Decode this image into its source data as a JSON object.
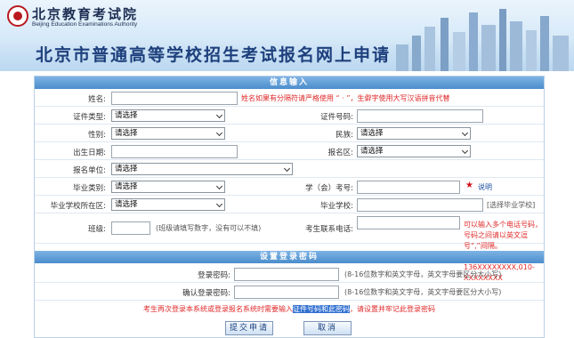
{
  "header": {
    "logo_cn": "北京教育考试院",
    "logo_en": "Beijing Education Examinations Authority",
    "title": "北京市普通高等学校招生考试报名网上申请"
  },
  "sections": {
    "info": "信息输入",
    "password": "设置登录密码"
  },
  "form": {
    "name_label": "姓名:",
    "name_note": "姓名如果有分隔符请严格使用 “ · ”，生僻字使用大写汉语拼音代替",
    "id_type_label": "证件类型:",
    "id_type_value": "请选择",
    "id_number_label": "证件号码:",
    "gender_label": "性别:",
    "gender_value": "请选择",
    "ethnicity_label": "民族:",
    "ethnicity_value": "请选择",
    "birthdate_label": "出生日期:",
    "district_label": "报名区:",
    "district_value": "请选择",
    "unit_label": "报名单位:",
    "unit_value": "请选择",
    "grad_type_label": "毕业类别:",
    "grad_type_value": "请选择",
    "student_id_label": "学（会）考号:",
    "student_id_star": "★",
    "student_id_link": "说明",
    "school_area_label": "毕业学校所在区:",
    "school_area_value": "请选择",
    "school_label": "毕业学校:",
    "school_button": "[选择毕业学校]",
    "class_label": "班级:",
    "class_note": "(班级请填写数字，没有可以不填)",
    "phone_label": "考生联系电话:",
    "phone_note_1": "可以输入多个电话号码，号码之间请以英文逗号“,”间隔。",
    "phone_note_2": "例如：136XXXXXXXX,010-XXXXXXXX"
  },
  "password": {
    "login_label": "登录密码:",
    "login_note": "(8-16位数字和英文字母，英文字母要区分大小写)",
    "confirm_label": "确认登录密码:",
    "confirm_note": "(8-16位数字和英文字母，英文字母要区分大小写)",
    "warning_a": "考生再次登录本系统或登录报名系统时需要输入",
    "warning_hl": "证件号码和此密码",
    "warning_b": "，请设置并牢记此登录密码"
  },
  "buttons": {
    "submit": "提交申请",
    "cancel": "取消"
  },
  "colors": {
    "section_bar": "#4a8dcc",
    "title": "#1d3f7c",
    "note_red": "#e02a2a",
    "star_red": "#d0121a"
  }
}
